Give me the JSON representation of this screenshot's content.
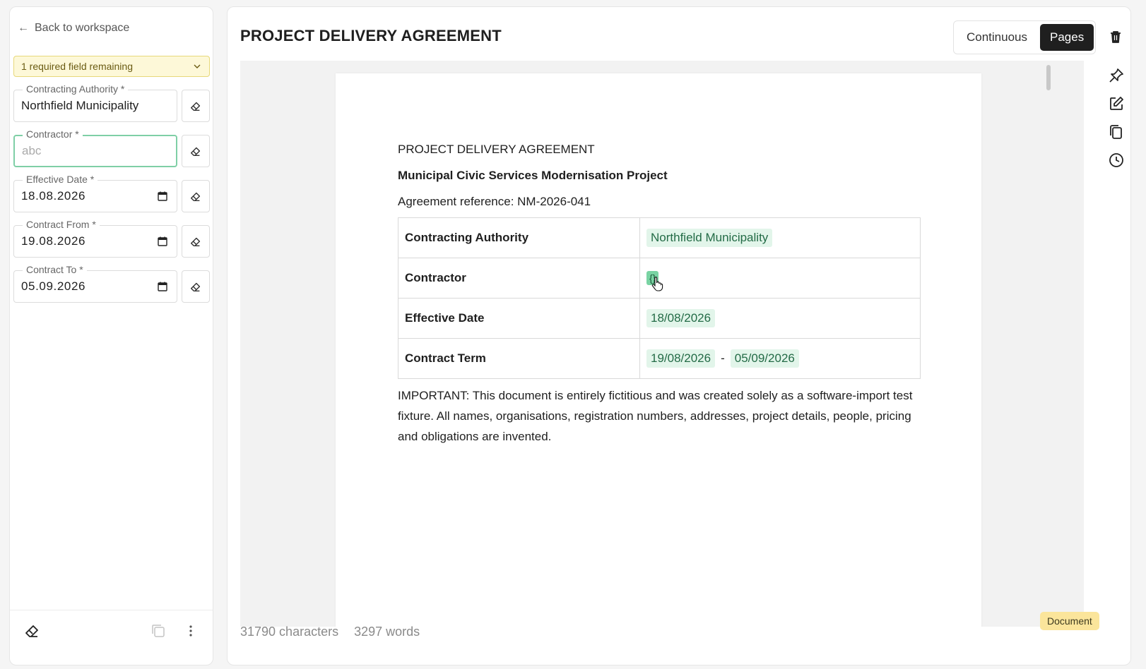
{
  "sidebar": {
    "back_label": "Back to workspace",
    "required_banner": "1 required field remaining",
    "fields": [
      {
        "label": "Contracting Authority *",
        "value": "Northfield Municipality"
      },
      {
        "label": "Contractor *",
        "value": "",
        "placeholder": "abc"
      },
      {
        "label": "Effective Date *",
        "value": "18.08.2026"
      },
      {
        "label": "Contract From *",
        "value": "19.08.2026"
      },
      {
        "label": "Contract To *",
        "value": "05.09.2026"
      }
    ]
  },
  "header": {
    "title": "PROJECT DELIVERY AGREEMENT",
    "view_modes": [
      "Continuous",
      "Pages"
    ],
    "active_view": "Pages"
  },
  "document": {
    "heading": "PROJECT DELIVERY AGREEMENT",
    "subheading": "Municipal Civic Services Modernisation Project",
    "reference": "Agreement reference: NM-2026-041",
    "table": [
      {
        "key": "Contracting Authority",
        "value": "Northfield Municipality"
      },
      {
        "key": "Contractor",
        "value": "{}"
      },
      {
        "key": "Effective Date",
        "value": "18/08/2026"
      },
      {
        "key": "Contract Term",
        "from": "19/08/2026",
        "sep": "-",
        "to": "05/09/2026"
      }
    ],
    "note": "IMPORTANT: This document is entirely fictitious and was created solely as a software-import test fixture. All names, organisations, registration numbers, addresses, project details, people, pricing and obligations are invented."
  },
  "status": {
    "characters": "31790 characters",
    "words": "3297 words",
    "badge": "Document"
  },
  "icons": {
    "back": "arrow-left-icon",
    "banner": "chevron-down-icon",
    "clear": "eraser-icon",
    "calendar": "calendar-icon",
    "trash": "trash-icon",
    "pin": "pin-icon",
    "edit": "edit-icon",
    "copy": "copy-icon",
    "history": "history-icon",
    "more": "more-vertical-icon"
  },
  "colors": {
    "accent_green": "#7fcfa6",
    "chip_bg": "#e2f5ea",
    "banner_bg": "#fdf8d8",
    "badge_bg": "#fbe59b"
  }
}
